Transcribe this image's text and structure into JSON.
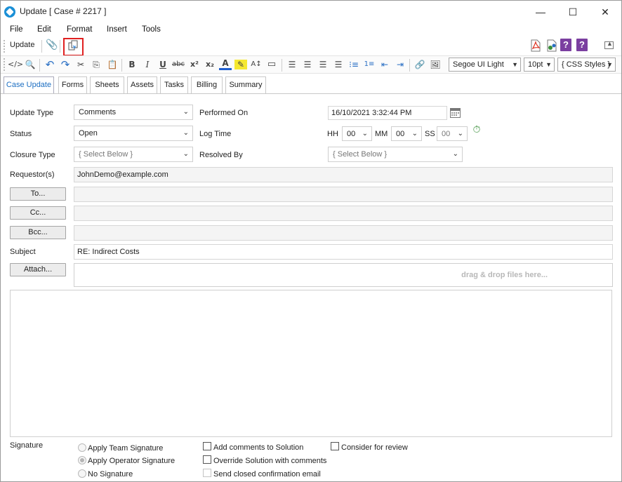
{
  "window": {
    "title": "Update [ Case # 2217 ]",
    "minimize": "—",
    "maximize": "☐",
    "close": "✕"
  },
  "menu": [
    "File",
    "Edit",
    "Format",
    "Insert",
    "Tools"
  ],
  "toolbar1": {
    "update_label": "Update"
  },
  "toolbar2": {
    "font": "Segoe UI Light",
    "size": "10pt",
    "styles": "{ CSS Styles }"
  },
  "tabs": [
    "Case Update",
    "Forms",
    "Sheets",
    "Assets",
    "Tasks",
    "Billing",
    "Summary"
  ],
  "form": {
    "update_type_label": "Update Type",
    "update_type_value": "Comments",
    "performed_on_label": "Performed On",
    "performed_on_value": "16/10/2021 3:32:44 PM",
    "status_label": "Status",
    "status_value": "Open",
    "log_time_label": "Log Time",
    "hh_label": "HH",
    "hh_value": "00",
    "mm_label": "MM",
    "mm_value": "00",
    "ss_label": "SS",
    "ss_value": "00",
    "closure_type_label": "Closure Type",
    "closure_type_value": "{ Select Below }",
    "resolved_by_label": "Resolved By",
    "resolved_by_value": "{ Select Below }",
    "requestors_label": "Requestor(s)",
    "requestors_value": "JohnDemo@example.com",
    "to_button": "To...",
    "cc_button": "Cc...",
    "bcc_button": "Bcc...",
    "to_value": "",
    "cc_value": "",
    "bcc_value": "",
    "subject_label": "Subject",
    "subject_value": "RE: Indirect Costs",
    "attach_button": "Attach...",
    "dropzone_text": "drag & drop files here..."
  },
  "signature": {
    "label": "Signature",
    "options": [
      "Apply Team Signature",
      "Apply Operator Signature",
      "No Signature"
    ],
    "selected": "Apply Operator Signature"
  },
  "checkboxes": {
    "add_comments": "Add comments to Solution",
    "override_solution": "Override Solution with comments",
    "send_closed": "Send closed confirmation email",
    "consider_review": "Consider for review"
  }
}
